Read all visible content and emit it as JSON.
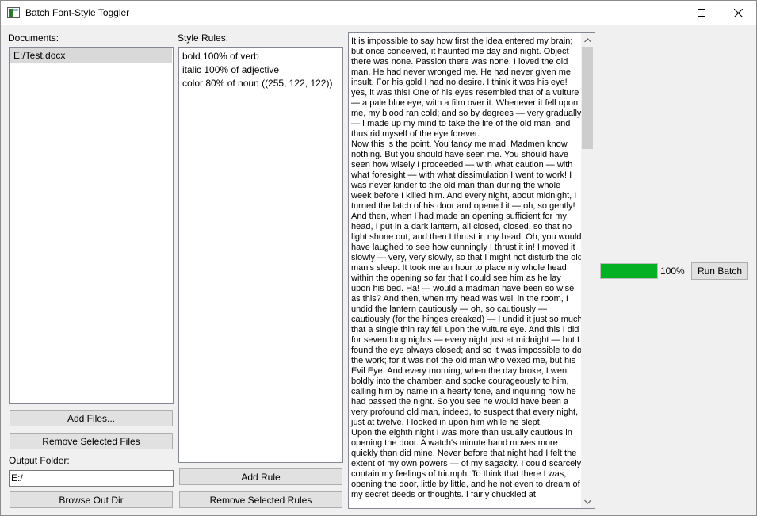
{
  "window": {
    "title": "Batch Font-Style Toggler",
    "icon": "app-window-icon",
    "controls": [
      "minimize-icon",
      "maximize-icon",
      "close-icon"
    ]
  },
  "documents": {
    "label": "Documents:",
    "items": [
      "E:/Test.docx"
    ],
    "selected_index": 0,
    "add_button": "Add Files...",
    "remove_button": "Remove Selected Files"
  },
  "output": {
    "label": "Output Folder:",
    "value": "E:/",
    "browse_button": "Browse Out Dir"
  },
  "rules": {
    "label": "Style Rules:",
    "items": [
      "bold 100% of verb",
      "italic 100% of adjective",
      "color 80% of noun ((255, 122, 122))"
    ],
    "add_button": "Add Rule",
    "remove_button": "Remove Selected Rules"
  },
  "preview": {
    "paragraphs": [
      "It is impossible to say how first the idea entered my brain; but once conceived, it haunted me day and night. Object there was none. Passion there was none. I loved the old man. He had never wronged me. He had never given me insult. For his gold I had no desire. I think it was his eye! yes, it was this! One of his eyes resembled that of a vulture — a pale blue eye, with a film over it. Whenever it fell upon me, my blood ran cold; and so by degrees — very gradually — I made up my mind to take the life of the old man, and thus rid myself of the eye forever.",
      "Now this is the point. You fancy me mad. Madmen know nothing. But you should have seen me. You should have seen how wisely I proceeded — with what caution — with what foresight — with what dissimulation I went to work! I was never kinder to the old man than during the whole week before I killed him. And every night, about midnight, I turned the latch of his door and opened it — oh, so gently! And then, when I had made an opening sufficient for my head, I put in a dark lantern, all closed, closed, so that no light shone out, and then I thrust in my head. Oh, you would have laughed to see how cunningly I thrust it in! I moved it slowly — very, very slowly, so that I might not disturb the old man's sleep. It took me an hour to place my whole head within the opening so far that I could see him as he lay upon his bed. Ha! — would a madman have been so wise as this? And then, when my head was well in the room, I undid the lantern cautiously — oh, so cautiously — cautiously (for the hinges creaked) — I undid it just so much that a single thin ray fell upon the vulture eye. And this I did for seven long nights — every night just at midnight — but I found the eye always closed; and so it was impossible to do the work; for it was not the old man who vexed me, but his Evil Eye. And every morning, when the day broke, I went boldly into the chamber, and spoke courageously to him, calling him by name in a hearty tone, and inquiring how he had passed the night. So you see he would have been a very profound old man, indeed, to suspect that every night, just at twelve, I looked in upon him while he slept.",
      "Upon the eighth night I was more than usually cautious in opening the door. A watch's minute hand moves more quickly than did mine. Never before that night had I felt the extent of my own powers — of my sagacity. I could scarcely contain my feelings of triumph. To think that there I was, opening the door, little by little, and he not even to dream of my secret deeds or thoughts. I fairly chuckled at"
    ]
  },
  "progress": {
    "fraction": 1.0,
    "label": "100%",
    "color": "#06b025"
  },
  "run_button": "Run Batch"
}
